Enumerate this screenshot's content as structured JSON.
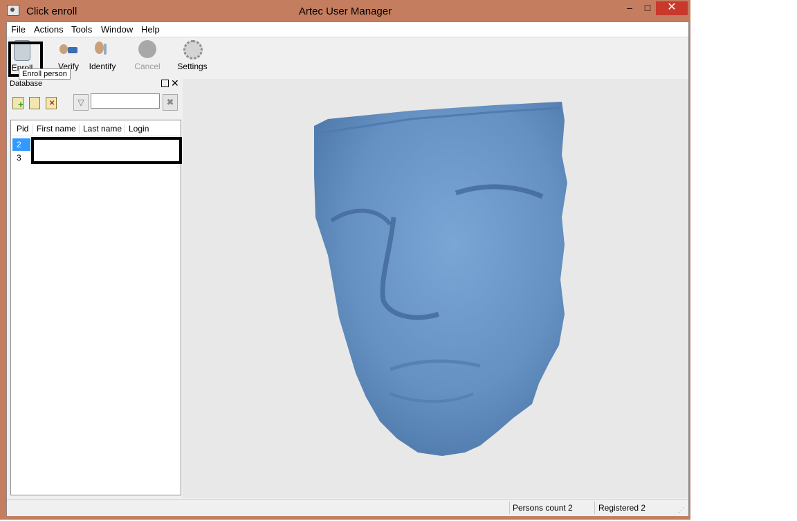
{
  "window": {
    "caption_left": "Click enroll",
    "title": "Artec User Manager",
    "min_glyph": "–",
    "max_glyph": "□",
    "close_glyph": "✕"
  },
  "menu": [
    "File",
    "Actions",
    "Tools",
    "Window",
    "Help"
  ],
  "toolbar": {
    "enroll_label": "Enroll",
    "verify_label": "Verify",
    "identify_label": "Identify",
    "cancel_label": "Cancel",
    "settings_label": "Settings",
    "tooltip": "Enroll person"
  },
  "database": {
    "title": "Database",
    "filter_value": "",
    "columns": [
      "Pid",
      "First name",
      "Last name",
      "Login"
    ],
    "rows": [
      {
        "pid": "2",
        "first": "",
        "last": "",
        "login": ""
      },
      {
        "pid": "3",
        "first": "",
        "last": "",
        "login": ""
      }
    ]
  },
  "viewport": {
    "face_color": "#6a96c8",
    "background": "#e8e8e8"
  },
  "status": {
    "persons": "Persons count 2",
    "registered": "Registered 2"
  }
}
